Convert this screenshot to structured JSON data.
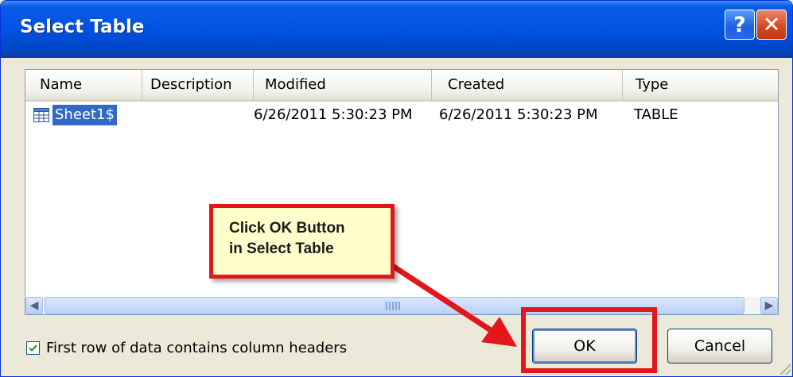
{
  "dialog": {
    "title": "Select Table",
    "help_label": "?",
    "close_label": "✕"
  },
  "table": {
    "columns": [
      "Name",
      "Description",
      "Modified",
      "Created",
      "Type"
    ],
    "rows": [
      {
        "name": "Sheet1$",
        "description": "",
        "modified": "6/26/2011 5:30:23 PM",
        "created": "6/26/2011 5:30:23 PM",
        "type": "TABLE",
        "icon": "table-icon",
        "selected": true
      }
    ]
  },
  "scrollbar": {
    "left_arrow": "◀",
    "right_arrow": "▶"
  },
  "options": {
    "first_row_headers_label": "First row of data contains column headers",
    "first_row_headers_checked": true
  },
  "buttons": {
    "ok_label": "OK",
    "cancel_label": "Cancel"
  },
  "annotation": {
    "callout_text": "Click OK Button\nin Select Table",
    "color": "#e3161b",
    "callout_bg": "#ffffcc"
  },
  "colors": {
    "titlebar": "#0054e3",
    "selection": "#316ac5",
    "window_bg": "#ece9d8"
  }
}
